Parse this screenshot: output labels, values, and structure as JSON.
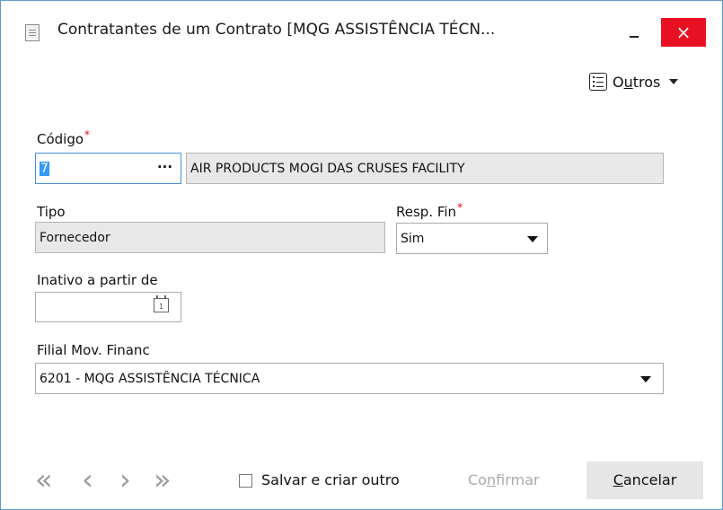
{
  "window": {
    "title": "Contratantes de um Contrato [MQG ASSISTÊNCIA TÉCN...",
    "close_glyph": "×",
    "icon": "document-icon"
  },
  "toolbar": {
    "outros_label_prefix": "O",
    "outros_label_underlined": "u",
    "outros_label_suffix": "tros",
    "icon": "list-icon"
  },
  "form": {
    "codigo": {
      "label": "Código",
      "required_mark": "*",
      "value": "7",
      "lookup_button": "···",
      "description": "AIR PRODUCTS MOGI DAS CRUSES FACILITY"
    },
    "tipo": {
      "label": "Tipo",
      "value": "Fornecedor"
    },
    "resp_fin": {
      "label": "Resp. Fin",
      "required_mark": "*",
      "value": "Sim"
    },
    "inativo": {
      "label": "Inativo a partir de",
      "value": "",
      "calendar_day": "1"
    },
    "filial": {
      "label": "Filial Mov. Financ",
      "value": "6201 - MQG ASSISTÊNCIA TÉCNICA"
    }
  },
  "footer": {
    "nav": {
      "first": "«",
      "prev": "‹",
      "next": "›",
      "last": "»"
    },
    "save_and_new_label": "Salvar e criar outro",
    "save_and_new_checked": false,
    "confirm_prefix": "Co",
    "confirm_underlined": "n",
    "confirm_suffix": "firmar",
    "cancel_underlined": "C",
    "cancel_suffix": "ancelar"
  },
  "colors": {
    "close_bg": "#e81123",
    "focus_border": "#4a90d9",
    "selection": "#3399ff",
    "readonly_bg": "#e8e8e8",
    "required": "#ee0000"
  }
}
